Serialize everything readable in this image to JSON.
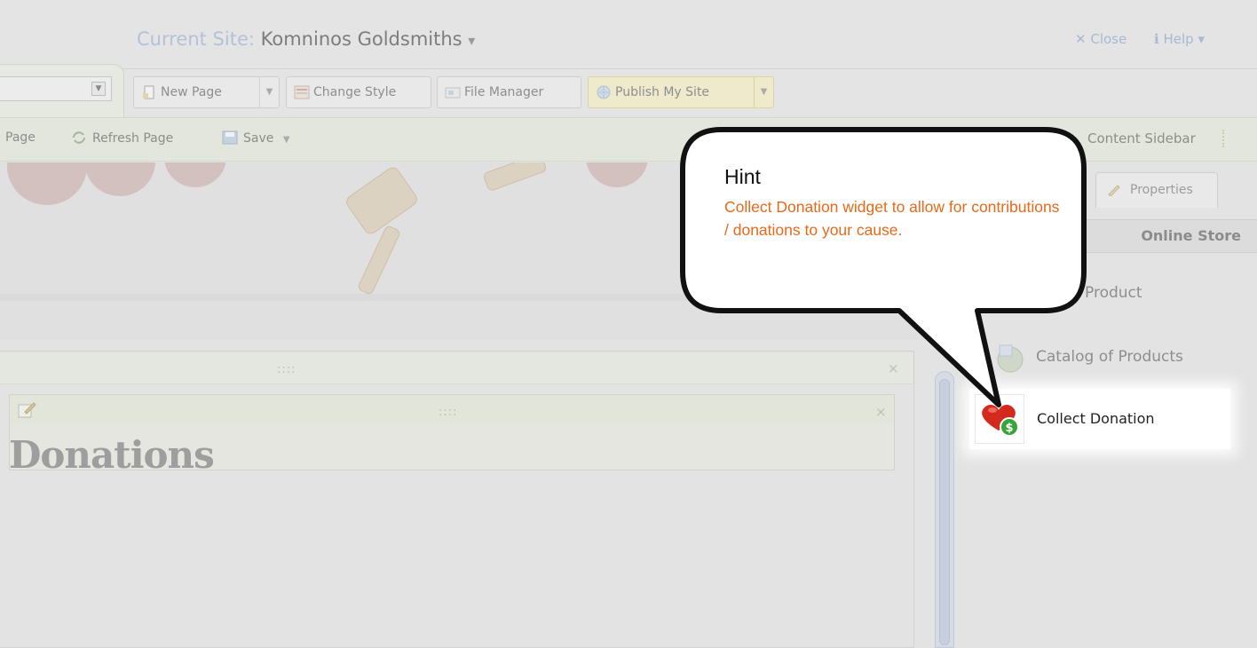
{
  "header": {
    "site_label": "Current Site:",
    "site_name": "Komninos Goldsmiths",
    "site_caret": "▾",
    "close_label": "Close",
    "help_label": "Help"
  },
  "toolbar": {
    "new_page": "New Page",
    "change_style": "Change Style",
    "file_manager": "File Manager",
    "publish": "Publish My Site",
    "page_select_value": ""
  },
  "toolbar2": {
    "page_label": "Page",
    "refresh": "Refresh Page",
    "save": "Save",
    "content_sidebar": "Content Sidebar"
  },
  "editor": {
    "heading": "Donations",
    "grip": "::::"
  },
  "sidebar": {
    "properties_tab": "Properties",
    "category": "Online Store",
    "items": [
      {
        "label": "Product",
        "visible_fragment": "Product"
      },
      {
        "label": "Catalog of Products"
      },
      {
        "label": "Collect Donation"
      }
    ]
  },
  "hint": {
    "title": "Hint",
    "body": "Collect Donation widget to allow for contributions / donations to your cause."
  },
  "colors": {
    "hint_text": "#e8691a",
    "overlay_bg": "#e3e3e3",
    "highlight_bg": "#ffffff"
  },
  "icons": [
    "close-icon",
    "help-icon",
    "new-page-icon",
    "change-style-icon",
    "file-manager-icon",
    "publish-icon",
    "refresh-icon",
    "save-icon",
    "properties-icon",
    "edit-icon",
    "catalog-icon",
    "donation-icon"
  ]
}
